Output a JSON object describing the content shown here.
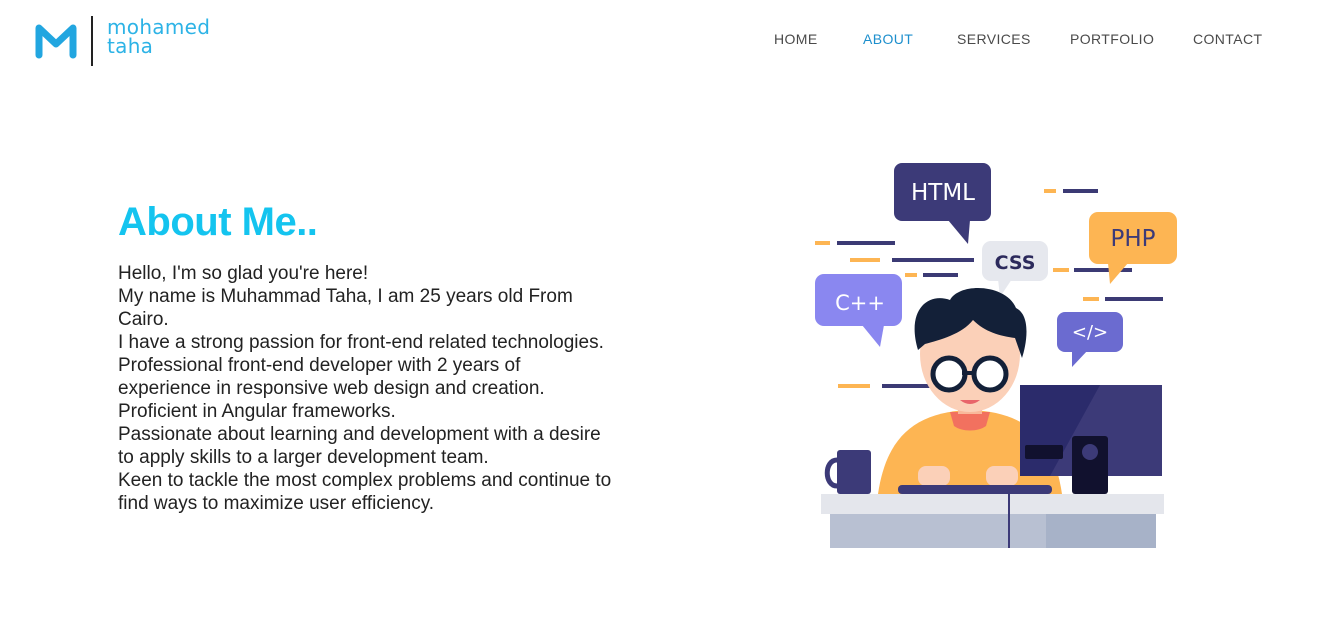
{
  "brand": {
    "name_line1": "mohamed",
    "name_line2": "taha",
    "accent": "#2db3e6"
  },
  "nav": {
    "items": [
      {
        "label": "HOME",
        "active": false
      },
      {
        "label": "ABOUT",
        "active": true
      },
      {
        "label": "SERVICES",
        "active": false
      },
      {
        "label": "PORTFOLIO",
        "active": false
      },
      {
        "label": "CONTACT",
        "active": false
      }
    ]
  },
  "about": {
    "heading": "About Me..",
    "lines": [
      "Hello, I'm so glad you're here!",
      "My name is Muhammad Taha, I am 25 years old From Cairo.",
      "I have a strong passion for front-end related technologies.",
      "Professional front-end developer with 2 years of experience in responsive web design and creation.",
      "Proficient in Angular frameworks.",
      "Passionate about learning and development with a desire to apply skills to a larger development team.",
      "Keen to tackle the most complex problems and continue to find ways to maximize user efficiency."
    ]
  },
  "illustration": {
    "bubbles": {
      "html": "HTML",
      "css": "CSS",
      "php": "PHP",
      "cpp": "C++",
      "code": "</>"
    }
  },
  "colors": {
    "heading": "#14c4ef",
    "nav_active": "#1d8fcd",
    "nav_text": "#4a4a4a",
    "body_text": "#222222"
  }
}
